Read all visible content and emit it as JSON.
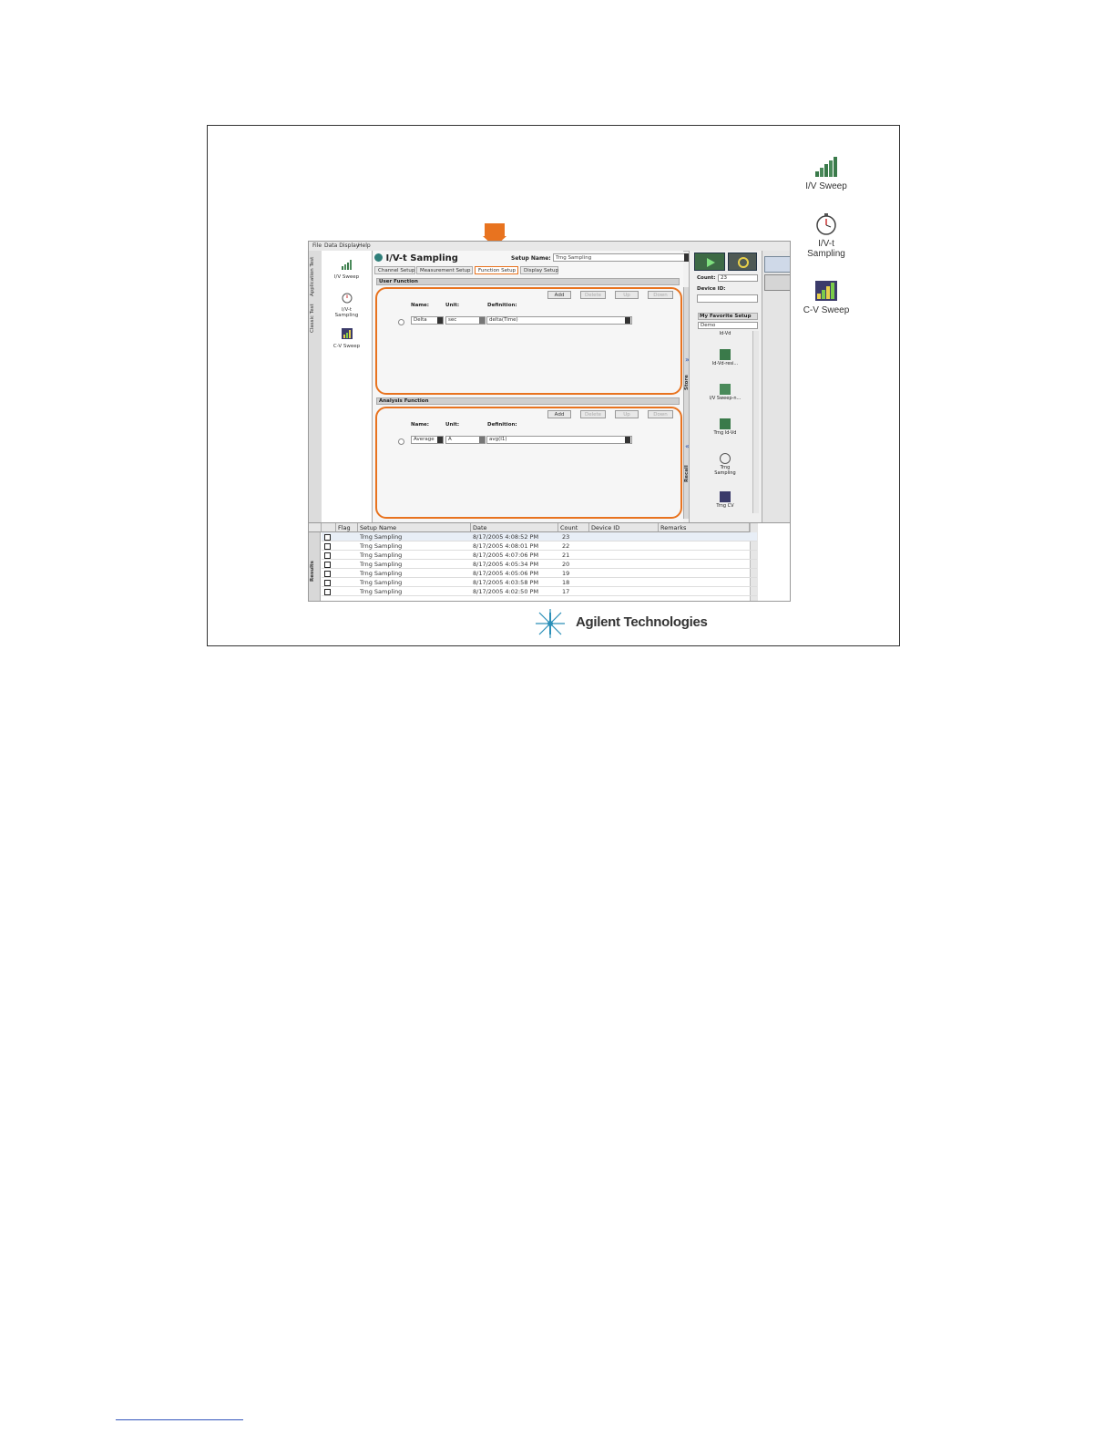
{
  "desktop_icons": [
    {
      "label": "I/V Sweep",
      "icon": "iv-sweep-icon"
    },
    {
      "label": "I/V-t Sampling",
      "icon": "stopwatch-icon"
    },
    {
      "label": "C-V Sweep",
      "icon": "cv-sweep-icon"
    }
  ],
  "app": {
    "menu": [
      "File",
      "Data Display",
      "Help"
    ],
    "vertical_tabs": [
      "Application Test",
      "Classic Test"
    ],
    "sidebar_items": [
      {
        "label": "I/V Sweep",
        "icon": "iv-sweep-icon"
      },
      {
        "label": "I/V-t Sampling",
        "icon": "stopwatch-icon"
      },
      {
        "label": "C-V Sweep",
        "icon": "cv-sweep-icon"
      }
    ],
    "title": "I/V-t Sampling",
    "setup_name_label": "Setup Name:",
    "setup_name_value": "Trng Sampling",
    "tabs": [
      "Channel Setup",
      "Measurement Setup",
      "Function Setup",
      "Display Setup"
    ],
    "active_tab": "Function Setup",
    "user_function": {
      "header": "User Function",
      "buttons": [
        "Add",
        "Delete",
        "Up",
        "Down"
      ],
      "columns": {
        "name": "Name:",
        "unit": "Unit:",
        "definition": "Definition:"
      },
      "row": {
        "name": "Delta",
        "unit": "sec",
        "definition": "delta(Time)"
      }
    },
    "analysis_function": {
      "header": "Analysis Function",
      "buttons": [
        "Add",
        "Delete",
        "Up",
        "Down"
      ],
      "columns": {
        "name": "Name:",
        "unit": "Unit:",
        "definition": "Definition:"
      },
      "row": {
        "name": "Average",
        "unit": "A",
        "definition": "avg(I1)"
      }
    },
    "side_labels": {
      "store": "Store",
      "recall": "Recall"
    },
    "right_panel": {
      "count_label": "Count:",
      "count_value": "23",
      "device_id_label": "Device ID:",
      "favorites_label": "My Favorite Setup",
      "favorites_value": "Demo",
      "items": [
        "Id-Vd",
        "Id-Vd-resi...",
        "I/V Sweep-n...",
        "Trng Id-Vd",
        "Trng Sampling",
        "Trng CV"
      ]
    },
    "results": {
      "side_label": "Results",
      "columns": [
        "Flag",
        "Setup Name",
        "Date",
        "Count",
        "Device ID",
        "Remarks"
      ],
      "rows": [
        {
          "setup": "Trng Sampling",
          "date": "8/17/2005 4:08:52 PM",
          "count": "23"
        },
        {
          "setup": "Trng Sampling",
          "date": "8/17/2005 4:08:01 PM",
          "count": "22"
        },
        {
          "setup": "Trng Sampling",
          "date": "8/17/2005 4:07:06 PM",
          "count": "21"
        },
        {
          "setup": "Trng Sampling",
          "date": "8/17/2005 4:05:34 PM",
          "count": "20"
        },
        {
          "setup": "Trng Sampling",
          "date": "8/17/2005 4:05:06 PM",
          "count": "19"
        },
        {
          "setup": "Trng Sampling",
          "date": "8/17/2005 4:03:58 PM",
          "count": "18"
        },
        {
          "setup": "Trng Sampling",
          "date": "8/17/2005 4:02:50 PM",
          "count": "17"
        }
      ]
    }
  },
  "logo": "Agilent Technologies",
  "colors": {
    "highlight": "#e8731f",
    "run": "#3d6a45"
  }
}
